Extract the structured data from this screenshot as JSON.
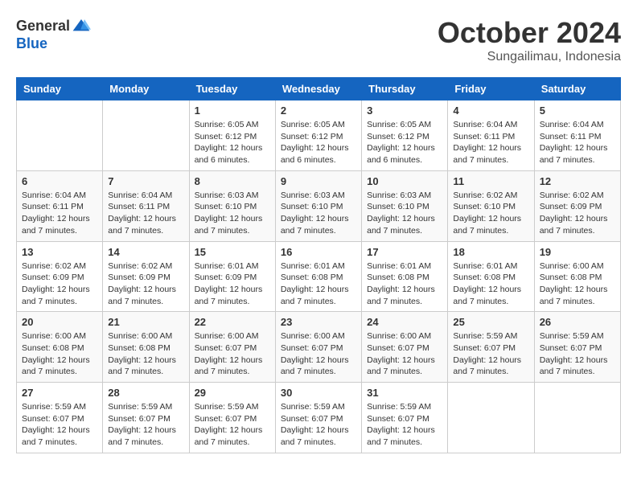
{
  "header": {
    "logo_general": "General",
    "logo_blue": "Blue",
    "month_title": "October 2024",
    "subtitle": "Sungailimau, Indonesia"
  },
  "days_of_week": [
    "Sunday",
    "Monday",
    "Tuesday",
    "Wednesday",
    "Thursday",
    "Friday",
    "Saturday"
  ],
  "weeks": [
    [
      {
        "day": "",
        "info": ""
      },
      {
        "day": "",
        "info": ""
      },
      {
        "day": "1",
        "info": "Sunrise: 6:05 AM\nSunset: 6:12 PM\nDaylight: 12 hours and 6 minutes."
      },
      {
        "day": "2",
        "info": "Sunrise: 6:05 AM\nSunset: 6:12 PM\nDaylight: 12 hours and 6 minutes."
      },
      {
        "day": "3",
        "info": "Sunrise: 6:05 AM\nSunset: 6:12 PM\nDaylight: 12 hours and 6 minutes."
      },
      {
        "day": "4",
        "info": "Sunrise: 6:04 AM\nSunset: 6:11 PM\nDaylight: 12 hours and 7 minutes."
      },
      {
        "day": "5",
        "info": "Sunrise: 6:04 AM\nSunset: 6:11 PM\nDaylight: 12 hours and 7 minutes."
      }
    ],
    [
      {
        "day": "6",
        "info": "Sunrise: 6:04 AM\nSunset: 6:11 PM\nDaylight: 12 hours and 7 minutes."
      },
      {
        "day": "7",
        "info": "Sunrise: 6:04 AM\nSunset: 6:11 PM\nDaylight: 12 hours and 7 minutes."
      },
      {
        "day": "8",
        "info": "Sunrise: 6:03 AM\nSunset: 6:10 PM\nDaylight: 12 hours and 7 minutes."
      },
      {
        "day": "9",
        "info": "Sunrise: 6:03 AM\nSunset: 6:10 PM\nDaylight: 12 hours and 7 minutes."
      },
      {
        "day": "10",
        "info": "Sunrise: 6:03 AM\nSunset: 6:10 PM\nDaylight: 12 hours and 7 minutes."
      },
      {
        "day": "11",
        "info": "Sunrise: 6:02 AM\nSunset: 6:10 PM\nDaylight: 12 hours and 7 minutes."
      },
      {
        "day": "12",
        "info": "Sunrise: 6:02 AM\nSunset: 6:09 PM\nDaylight: 12 hours and 7 minutes."
      }
    ],
    [
      {
        "day": "13",
        "info": "Sunrise: 6:02 AM\nSunset: 6:09 PM\nDaylight: 12 hours and 7 minutes."
      },
      {
        "day": "14",
        "info": "Sunrise: 6:02 AM\nSunset: 6:09 PM\nDaylight: 12 hours and 7 minutes."
      },
      {
        "day": "15",
        "info": "Sunrise: 6:01 AM\nSunset: 6:09 PM\nDaylight: 12 hours and 7 minutes."
      },
      {
        "day": "16",
        "info": "Sunrise: 6:01 AM\nSunset: 6:08 PM\nDaylight: 12 hours and 7 minutes."
      },
      {
        "day": "17",
        "info": "Sunrise: 6:01 AM\nSunset: 6:08 PM\nDaylight: 12 hours and 7 minutes."
      },
      {
        "day": "18",
        "info": "Sunrise: 6:01 AM\nSunset: 6:08 PM\nDaylight: 12 hours and 7 minutes."
      },
      {
        "day": "19",
        "info": "Sunrise: 6:00 AM\nSunset: 6:08 PM\nDaylight: 12 hours and 7 minutes."
      }
    ],
    [
      {
        "day": "20",
        "info": "Sunrise: 6:00 AM\nSunset: 6:08 PM\nDaylight: 12 hours and 7 minutes."
      },
      {
        "day": "21",
        "info": "Sunrise: 6:00 AM\nSunset: 6:08 PM\nDaylight: 12 hours and 7 minutes."
      },
      {
        "day": "22",
        "info": "Sunrise: 6:00 AM\nSunset: 6:07 PM\nDaylight: 12 hours and 7 minutes."
      },
      {
        "day": "23",
        "info": "Sunrise: 6:00 AM\nSunset: 6:07 PM\nDaylight: 12 hours and 7 minutes."
      },
      {
        "day": "24",
        "info": "Sunrise: 6:00 AM\nSunset: 6:07 PM\nDaylight: 12 hours and 7 minutes."
      },
      {
        "day": "25",
        "info": "Sunrise: 5:59 AM\nSunset: 6:07 PM\nDaylight: 12 hours and 7 minutes."
      },
      {
        "day": "26",
        "info": "Sunrise: 5:59 AM\nSunset: 6:07 PM\nDaylight: 12 hours and 7 minutes."
      }
    ],
    [
      {
        "day": "27",
        "info": "Sunrise: 5:59 AM\nSunset: 6:07 PM\nDaylight: 12 hours and 7 minutes."
      },
      {
        "day": "28",
        "info": "Sunrise: 5:59 AM\nSunset: 6:07 PM\nDaylight: 12 hours and 7 minutes."
      },
      {
        "day": "29",
        "info": "Sunrise: 5:59 AM\nSunset: 6:07 PM\nDaylight: 12 hours and 7 minutes."
      },
      {
        "day": "30",
        "info": "Sunrise: 5:59 AM\nSunset: 6:07 PM\nDaylight: 12 hours and 7 minutes."
      },
      {
        "day": "31",
        "info": "Sunrise: 5:59 AM\nSunset: 6:07 PM\nDaylight: 12 hours and 7 minutes."
      },
      {
        "day": "",
        "info": ""
      },
      {
        "day": "",
        "info": ""
      }
    ]
  ]
}
